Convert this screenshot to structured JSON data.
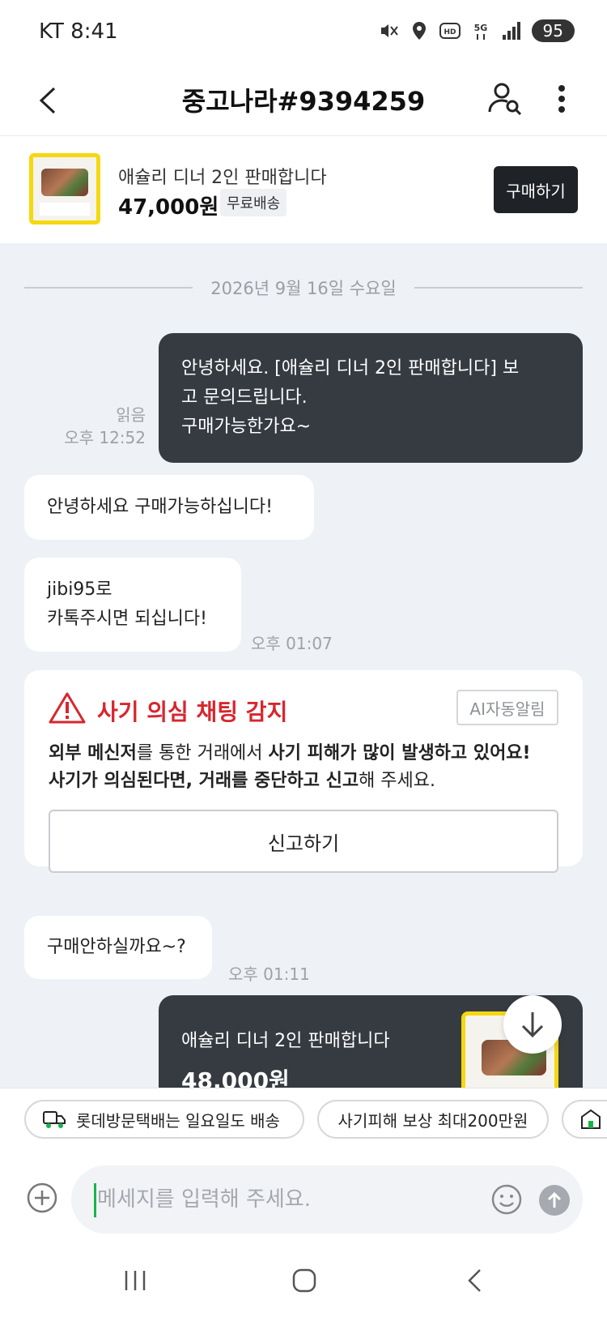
{
  "status_bar": {
    "carrier_time": "KT 8:41",
    "battery": "95",
    "icons": [
      "mute-vibrate-icon",
      "location-icon",
      "hd-icon",
      "5g-icon",
      "signal-icon",
      "battery-icon"
    ]
  },
  "header": {
    "title": "중고나라#9394259",
    "icons": [
      "back-arrow-icon",
      "user-search-icon",
      "more-vertical-icon"
    ]
  },
  "product": {
    "title": "애슐리 디너 2인 판매합니다",
    "price": "47,000원",
    "shipping_badge": "무료배송",
    "buy_button": "구매하기"
  },
  "chat": {
    "date_divider": "2026년 9월 16일 수요일",
    "messages": [
      {
        "from": "me",
        "lines": [
          "안녕하세요. [애슐리 디너 2인 판매합니다] 보",
          "고 문의드립니다.",
          "구매가능한가요~"
        ],
        "status": "읽음",
        "time": "오후 12:52"
      },
      {
        "from": "other",
        "lines": [
          "안녕하세요 구매가능하십니다!"
        ]
      },
      {
        "from": "other",
        "lines": [
          "jibi95로",
          "카톡주시면 되십니다!"
        ],
        "time": "오후 01:07"
      },
      {
        "from": "other",
        "lines": [
          "구매안하실까요~?"
        ],
        "time": "오후 01:11"
      }
    ],
    "warning": {
      "title": "사기 의심 채팅 감지",
      "badge": "AI자동알림",
      "body_parts": [
        "외부 메신저",
        "를 통한 거래에서 ",
        "사기 피해가 많이 발생하고 있어요! 사기가 의심된다면, 거래를 중단하고 신고",
        "해 주세요."
      ],
      "report_button": "신고하기",
      "accent_color": "#d7262e"
    },
    "product_card": {
      "title": "애슐리 디너 2인 판매합니다",
      "price": "48,000원"
    }
  },
  "chips": [
    {
      "label": "롯데방문택배는 일요일도 배송",
      "icon": "delivery-truck-icon"
    },
    {
      "label": "사기피해 보상 최대200만원",
      "icon": ""
    },
    {
      "label": "",
      "icon": "shield-house-icon"
    }
  ],
  "input": {
    "placeholder": "메세지를 입력해 주세요.",
    "value": ""
  },
  "nav": [
    "recent-apps-icon",
    "home-icon",
    "back-icon"
  ],
  "colors": {
    "chat_bg": "#eef1f5",
    "my_bubble": "#363b42",
    "accent_yellow": "#f5d80f",
    "caret_green": "#19b34a"
  }
}
